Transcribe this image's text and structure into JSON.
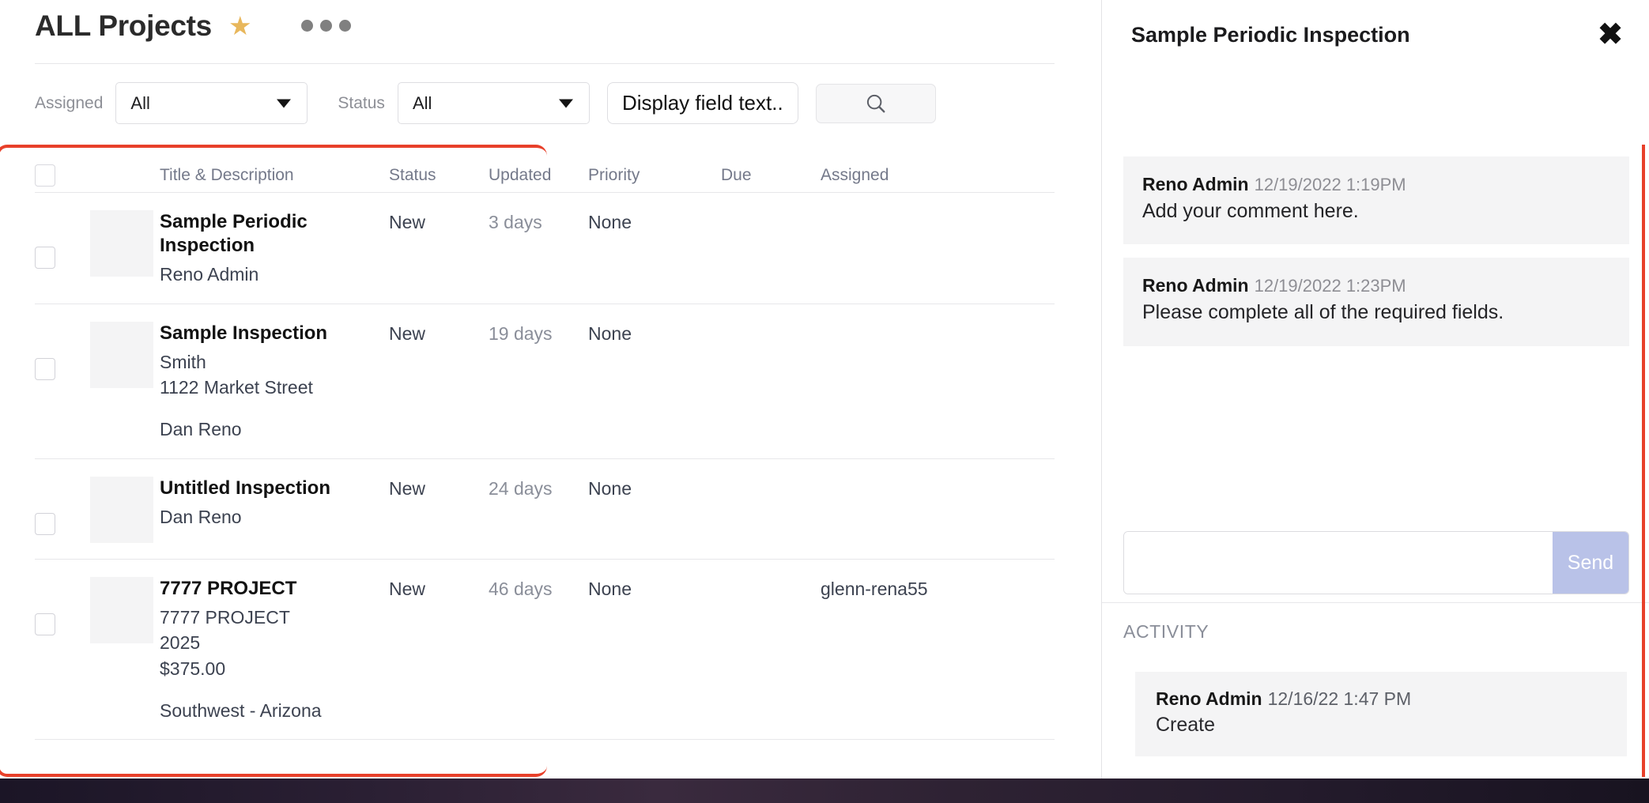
{
  "header": {
    "title": "ALL Projects",
    "star_icon": "star-icon",
    "more_icon": "more-options-icon"
  },
  "filters": {
    "assigned_label": "Assigned",
    "assigned_value": "All",
    "status_label": "Status",
    "status_value": "All",
    "display_field_label": "Display field text..",
    "search_icon": "search-icon",
    "search_placeholder": ""
  },
  "table": {
    "columns": [
      "Title & Description",
      "Status",
      "Updated",
      "Priority",
      "Due",
      "Assigned"
    ],
    "rows": [
      {
        "title": "Sample Periodic Inspection",
        "sub1": "Reno Admin",
        "sub2": "",
        "sub3": "",
        "sub4": "",
        "footer": "",
        "status": "New",
        "updated": "3 days",
        "priority": "None",
        "due": "",
        "assigned": ""
      },
      {
        "title": "Sample Inspection",
        "sub1": "Smith",
        "sub2": "1122 Market Street",
        "sub3": "",
        "sub4": "",
        "footer": "Dan Reno",
        "status": "New",
        "updated": "19 days",
        "priority": "None",
        "due": "",
        "assigned": ""
      },
      {
        "title": "Untitled Inspection",
        "sub1": "Dan Reno",
        "sub2": "",
        "sub3": "",
        "sub4": "",
        "footer": "",
        "status": "New",
        "updated": "24 days",
        "priority": "None",
        "due": "",
        "assigned": ""
      },
      {
        "title": "7777 PROJECT",
        "sub1": "7777 PROJECT",
        "sub2": "2025",
        "sub3": "$375.00",
        "sub4": "",
        "footer": "Southwest - Arizona",
        "status": "New",
        "updated": "46 days",
        "priority": "None",
        "due": "",
        "assigned": "glenn-rena55"
      }
    ]
  },
  "panel": {
    "title": "Sample Periodic Inspection",
    "close_icon": "close-icon",
    "highlight_color": "#e8402a",
    "comments": [
      {
        "author": "Reno Admin",
        "time": "12/19/2022 1:19PM",
        "body": "Add your comment here."
      },
      {
        "author": "Reno Admin",
        "time": "12/19/2022 1:23PM",
        "body": "Please complete all of the required fields."
      }
    ],
    "composer": {
      "value": "",
      "placeholder": "",
      "send_label": "Send",
      "send_color": "#b9c2e8"
    },
    "activity_label": "ACTIVITY",
    "activity": [
      {
        "author": "Reno Admin",
        "time": "12/16/22 1:47 PM",
        "body": "Create"
      }
    ]
  }
}
